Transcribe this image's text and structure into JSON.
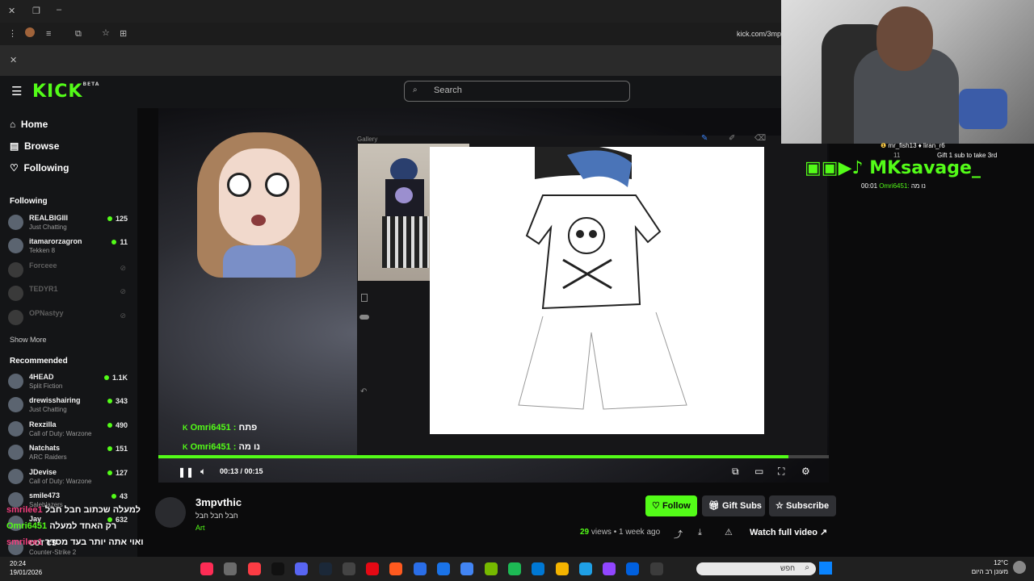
{
  "browser": {
    "url": "kick.com/3mp"
  },
  "header": {
    "logo": "KICK",
    "logo_badge": "BETA",
    "search_placeholder": "Search"
  },
  "sidebar": {
    "nav": [
      {
        "label": "Home",
        "icon": "home-icon"
      },
      {
        "label": "Browse",
        "icon": "browse-icon"
      },
      {
        "label": "Following",
        "icon": "heart-icon"
      }
    ],
    "following_title": "Following",
    "following": [
      {
        "name": "REALBIGIII",
        "game": "Just Chatting",
        "viewers": "125"
      },
      {
        "name": "itamarorzagron",
        "game": "Tekken 8",
        "viewers": "11"
      },
      {
        "name": "Forceee",
        "game": "",
        "viewers": ""
      },
      {
        "name": "TEDYR1",
        "game": "",
        "viewers": ""
      },
      {
        "name": "OPNastyy",
        "game": "",
        "viewers": ""
      }
    ],
    "show_more": "Show More",
    "recommended_title": "Recommended",
    "recommended": [
      {
        "name": "4HEAD",
        "game": "Split Fiction",
        "viewers": "1.1K"
      },
      {
        "name": "drewisshairing",
        "game": "Just Chatting",
        "viewers": "343"
      },
      {
        "name": "Rexzilla",
        "game": "Call of Duty: Warzone",
        "viewers": "490"
      },
      {
        "name": "Natchats",
        "game": "ARC Raiders",
        "viewers": "151"
      },
      {
        "name": "JDevise",
        "game": "Call of Duty: Warzone",
        "viewers": "127"
      },
      {
        "name": "smile473",
        "game": "Saleblazers",
        "viewers": "43"
      },
      {
        "name": "Jay",
        "game": "",
        "viewers": "632"
      },
      {
        "name": "COT CS",
        "game": "Counter-Strike 2",
        "viewers": ""
      }
    ]
  },
  "video": {
    "gallery_label": "Gallery",
    "time": "00:13 / 00:15",
    "progress": 0.94,
    "chat_overlay": [
      {
        "user": "Omri6451 :",
        "text": "פתח"
      },
      {
        "user": "Omri6451 :",
        "text": "נו מה"
      }
    ]
  },
  "channel": {
    "name": "3mpvthic",
    "subtitle": "חבל חבל חבל",
    "category": "Art",
    "follow": "Follow",
    "gift_subs": "Gift Subs",
    "subscribe": "Subscribe",
    "views": "29",
    "views_suffix": "views",
    "age": "1 week ago",
    "watch_full": "Watch full video"
  },
  "side_chat_overlay": [
    {
      "user": "smrilee1",
      "text": "למעלה שכתוב חבל חבל"
    },
    {
      "user": "Omri6451",
      "text": "רק האחד למעלה"
    },
    {
      "user": "smrilee1",
      "text": "ואוי אתה יותר בעד מסדר"
    }
  ],
  "webcam_overlay": {
    "name": "MKsavage_",
    "top_users": "mr_fish13 ♦ liran_r6",
    "gift_line": "Gift 1 sub to take 3rd",
    "count": "11",
    "chat_time": "00:01",
    "chat_user": "Omri6451:",
    "chat_text": "נו מה"
  },
  "taskbar": {
    "time": "20:24",
    "date": "19/01/2026",
    "weather_temp": "12°C",
    "weather_text": "מעונן רב היום",
    "search_label": "חפש"
  },
  "colors": {
    "accent": "#53fc18",
    "bg": "#0b0b0c",
    "sidebar": "#141517"
  }
}
